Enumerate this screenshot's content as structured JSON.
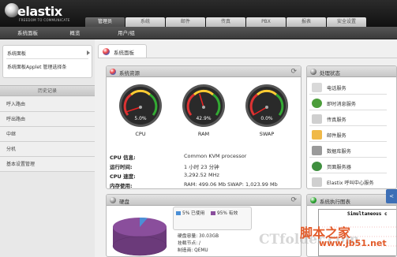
{
  "logo": {
    "word": "elastix",
    "tagline": "FREEDOM TO COMMUNICATE"
  },
  "tabs": [
    {
      "label": "管理员",
      "active": true
    },
    {
      "label": "系统",
      "active": false
    },
    {
      "label": "邮件",
      "active": false
    },
    {
      "label": "传真",
      "active": false
    },
    {
      "label": "PBX",
      "active": false
    },
    {
      "label": "报表",
      "active": false
    },
    {
      "label": "安全设置",
      "active": false
    }
  ],
  "subnav": [
    "系统面板",
    "概览",
    "用户/组"
  ],
  "sidebar": {
    "menu": [
      "系统面板",
      "系统面板Applet 管理选择条"
    ],
    "quick_header": "历史记录",
    "quick_items": [
      "呼入路由",
      "呼出路由",
      "中继",
      "分机",
      "基本设置管理"
    ]
  },
  "page_tab": "系统面板",
  "resources": {
    "title": "系统资源",
    "gauges": [
      {
        "label": "CPU",
        "value_text": "5.0%",
        "value": 5.0
      },
      {
        "label": "RAM",
        "value_text": "42.9%",
        "value": 42.9
      },
      {
        "label": "SWAP",
        "value_text": "0.0%",
        "value": 0.0
      }
    ],
    "info": [
      {
        "k": "CPU 信息:",
        "v": "Common KVM processor"
      },
      {
        "k": "运行时间:",
        "v": "1 小时 23 分钟"
      },
      {
        "k": "CPU 速度:",
        "v": "3,292.52 MHz"
      },
      {
        "k": "内存使用:",
        "v": "RAM: 499.06 Mb SWAP: 1,023.99 Mb"
      }
    ]
  },
  "processes": {
    "title": "处理状态",
    "items": [
      {
        "label": "电话服务",
        "icon": "phone-icon",
        "color": "#d9d9d9"
      },
      {
        "label": "即时消息服务",
        "icon": "chat-icon",
        "color": "#4b9d3a"
      },
      {
        "label": "传真服务",
        "icon": "fax-icon",
        "color": "#cfcfcf"
      },
      {
        "label": "邮件服务",
        "icon": "mail-icon",
        "color": "#f0b948"
      },
      {
        "label": "数据库服务",
        "icon": "database-icon",
        "color": "#9a9a9a"
      },
      {
        "label": "页面服务器",
        "icon": "globe-icon",
        "color": "#3f8f3f"
      },
      {
        "label": "Elastix 呼叫中心服务",
        "icon": "headset-icon",
        "color": "#cfcfcf"
      }
    ]
  },
  "disk": {
    "title": "硬盘",
    "legend_used": "5% 已使用",
    "legend_free": "95% 有效",
    "used_color": "#4b8fd6",
    "free_color": "#8a4e9c",
    "lines": [
      "硬盘容量: 30.03GB",
      "挂载节点: /",
      "制造商: QEMU"
    ]
  },
  "perf": {
    "title": "系统执行图表",
    "graph_title": "Simultaneous c"
  },
  "watermark": {
    "ct": "CTfolder.com",
    "cn": "脚本之家",
    "url": "www.jb51.net"
  },
  "side_button": "<"
}
